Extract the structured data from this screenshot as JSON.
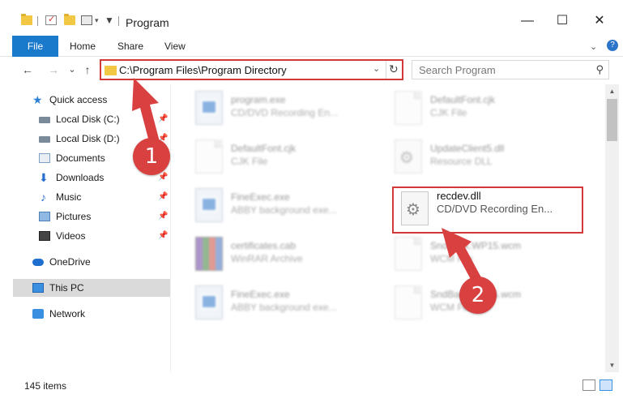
{
  "window": {
    "title": "Program",
    "minimize": "—",
    "maximize": "☐",
    "close": "✕"
  },
  "ribbon": {
    "file": "File",
    "home": "Home",
    "share": "Share",
    "view": "View",
    "expand": "⌄",
    "help": "?"
  },
  "nav_buttons": {
    "back": "←",
    "forward": "→",
    "recent": "⌄",
    "up": "↑"
  },
  "address": {
    "path": "C:\\Program Files\\Program Directory",
    "dropdown": "⌄",
    "refresh": "↻"
  },
  "search": {
    "placeholder": "Search Program",
    "icon": "⚲"
  },
  "nav_pane": {
    "items": [
      {
        "label": "Quick access",
        "icon": "star-icon"
      },
      {
        "label": "Local Disk (C:)",
        "icon": "drive-icon",
        "pinned": true
      },
      {
        "label": "Local Disk (D:)",
        "icon": "drive-icon",
        "pinned": true
      },
      {
        "label": "Documents",
        "icon": "documents-icon",
        "pinned": true
      },
      {
        "label": "Downloads",
        "icon": "downloads-icon",
        "pinned": true
      },
      {
        "label": "Music",
        "icon": "music-icon",
        "pinned": true
      },
      {
        "label": "Pictures",
        "icon": "pictures-icon",
        "pinned": true
      },
      {
        "label": "Videos",
        "icon": "videos-icon",
        "pinned": true
      },
      {
        "label": "OneDrive",
        "icon": "onedrive-icon"
      },
      {
        "label": "This PC",
        "icon": "computer-icon",
        "selected": true
      },
      {
        "label": "Network",
        "icon": "network-icon"
      }
    ],
    "pin_glyph": "📌"
  },
  "files": [
    {
      "name": "program.exe",
      "type": "CD/DVD Recording En...",
      "icon": "application-icon"
    },
    {
      "name": "DefaultFont.cjk",
      "type": "CJK File",
      "icon": "document-icon"
    },
    {
      "name": "DefaultFont.cjk",
      "type": "CJK File",
      "icon": "document-icon"
    },
    {
      "name": "UpdateClient5.dll",
      "type": "Resource DLL",
      "icon": "gear-document-icon"
    },
    {
      "name": "FineExec.exe",
      "type": "ABBY background exe...",
      "icon": "application-icon"
    },
    {
      "name": "recdev.dll",
      "type": "CD/DVD Recording En...",
      "icon": "gear-document-icon"
    },
    {
      "name": "certificates.cab",
      "type": "WinRAR Archive",
      "icon": "archive-icon"
    },
    {
      "name": "SndBack.WP15.wcm",
      "type": "WCM File",
      "icon": "document-icon"
    },
    {
      "name": "FineExec.exe",
      "type": "ABBY background exe...",
      "icon": "application-icon"
    },
    {
      "name": "SndBack.WP15.wcm",
      "type": "WCM File",
      "icon": "document-icon"
    }
  ],
  "status": {
    "item_count": "145 items"
  },
  "annotations": {
    "step1": "1",
    "step2": "2",
    "color": "#d94040"
  },
  "colors": {
    "accent": "#1979ca",
    "highlight": "#d23a3a",
    "selected_nav": "#dadada"
  }
}
